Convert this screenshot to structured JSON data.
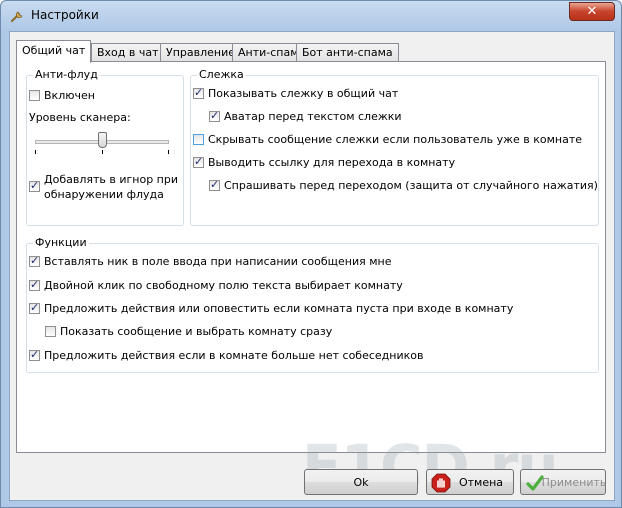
{
  "window": {
    "title": "Настройки",
    "close_label": "✕"
  },
  "tabs": [
    {
      "label": "Общий чат",
      "active": true
    },
    {
      "label": "Вход в чат"
    },
    {
      "label": "Управление"
    },
    {
      "label": "Анти-спам"
    },
    {
      "label": "Бот анти-спама"
    }
  ],
  "antiflood": {
    "legend": "Анти-флуд",
    "enabled_label": "Включен",
    "enabled": false,
    "scanner_label": "Уровень сканера:",
    "scanner_level": 0.55,
    "ignore_label_1": "Добавлять в игнор при",
    "ignore_label_2": "обнаружении флуда",
    "ignore_checked": true
  },
  "watch": {
    "legend": "Слежка",
    "items": [
      {
        "label": "Показывать слежку в общий чат",
        "checked": true
      },
      {
        "label": "Аватар перед текстом слежки",
        "checked": true
      },
      {
        "label": "Скрывать сообщение слежки если пользователь уже в комнате",
        "checked": false
      },
      {
        "label": "Выводить ссылку для перехода в комнату",
        "checked": true
      },
      {
        "label": "Спрашивать перед переходом (защита от случайного нажатия)",
        "checked": true
      }
    ]
  },
  "functions": {
    "legend": "Функции",
    "items": [
      {
        "label": "Вставлять ник в поле ввода при написании сообщения мне",
        "checked": true
      },
      {
        "label": "Двойной клик по свободному полю текста выбирает комнату",
        "checked": true
      },
      {
        "label": "Предложить действия или оповестить если комната пуста при входе в комнату",
        "checked": true
      },
      {
        "label": "Показать сообщение и выбрать комнату сразу",
        "checked": false
      },
      {
        "label": "Предложить действия если в комнате больше нет собеседников",
        "checked": true
      }
    ]
  },
  "buttons": {
    "ok": "Ok",
    "cancel": "Отмена",
    "apply": "Применить"
  },
  "watermark": "F1CD.ru"
}
